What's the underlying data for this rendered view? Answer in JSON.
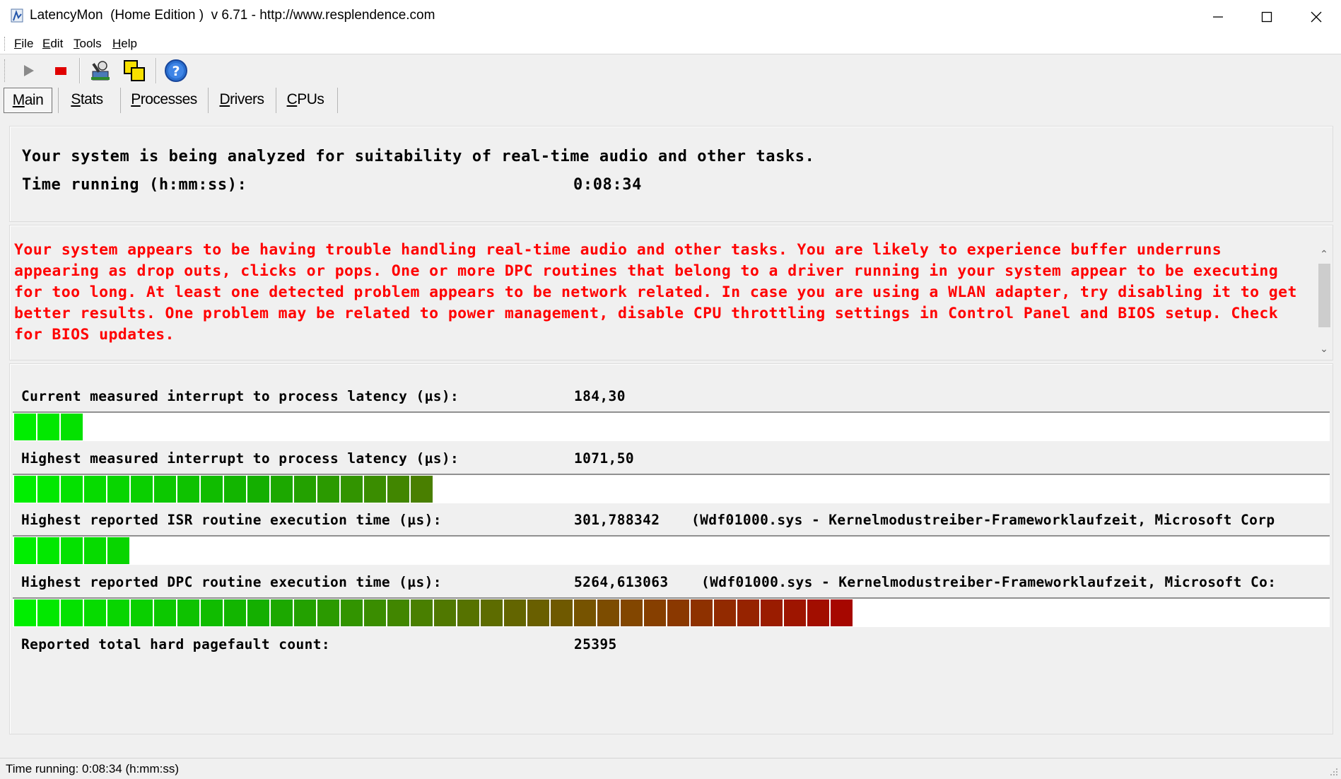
{
  "window": {
    "title": "LatencyMon  (Home Edition )  v 6.71 - http://www.resplendence.com",
    "minimize_icon": "minimize-icon",
    "maximize_icon": "maximize-icon",
    "close_icon": "close-icon"
  },
  "menu": {
    "items": [
      {
        "accel": "F",
        "rest": "ile"
      },
      {
        "accel": "E",
        "rest": "dit"
      },
      {
        "accel": "T",
        "rest": "ools"
      },
      {
        "accel": "H",
        "rest": "elp"
      }
    ]
  },
  "toolbar": {
    "icons": [
      "play-icon",
      "stop-icon",
      "analyze-icon",
      "windows-icon",
      "help-icon"
    ]
  },
  "tabs": [
    {
      "accel": "M",
      "rest": "ain",
      "active": true
    },
    {
      "accel": "S",
      "rest": "tats",
      "active": false
    },
    {
      "accel": "P",
      "rest": "rocesses",
      "active": false
    },
    {
      "accel": "D",
      "rest": "rivers",
      "active": false
    },
    {
      "accel": "C",
      "rest": "PUs",
      "active": false
    }
  ],
  "status_panel": {
    "analyzing_text": "Your system is being analyzed for suitability of real-time audio and other tasks.",
    "time_label": "Time running (h:mm:ss):",
    "time_value": "0:08:34"
  },
  "warning": {
    "text": "Your system appears to be having trouble handling real-time audio and other tasks. You are likely to experience buffer underruns appearing as drop outs, clicks or pops. One or more DPC routines that belong to a driver running in your system appear to be executing for too long. At least one detected problem appears to be network related. In case you are using a WLAN adapter, try disabling it to get better results. One problem may be related to power management, disable CPU throttling settings in Control Panel and BIOS setup. Check for BIOS updates.",
    "color": "#ff0000"
  },
  "metrics": [
    {
      "label": "Current measured interrupt to process latency (µs):",
      "value": "184,30",
      "extra": "",
      "bar_segments": 3
    },
    {
      "label": "Highest measured interrupt to process latency (µs):",
      "value": "1071,50",
      "extra": "",
      "bar_segments": 18
    },
    {
      "label": "Highest reported ISR routine execution time (µs):",
      "value": "301,788342",
      "extra": "(Wdf01000.sys - Kernelmodustreiber-Frameworklaufzeit, Microsoft Corp",
      "bar_segments": 5
    },
    {
      "label": "Highest reported DPC routine execution time (µs):",
      "value": "5264,613063",
      "extra": "(Wdf01000.sys - Kernelmodustreiber-Frameworklaufzeit, Microsoft Co:",
      "bar_segments": 36
    },
    {
      "label": "Reported total hard pagefault count:",
      "value": "25395",
      "extra": "",
      "bar_segments": 0
    }
  ],
  "statusbar": {
    "text": "Time running: 0:08:34  (h:mm:ss)"
  },
  "colors": {
    "bar_start": "#00ee00",
    "bar_end": "#aa0000",
    "warning_text": "#ff0000"
  }
}
